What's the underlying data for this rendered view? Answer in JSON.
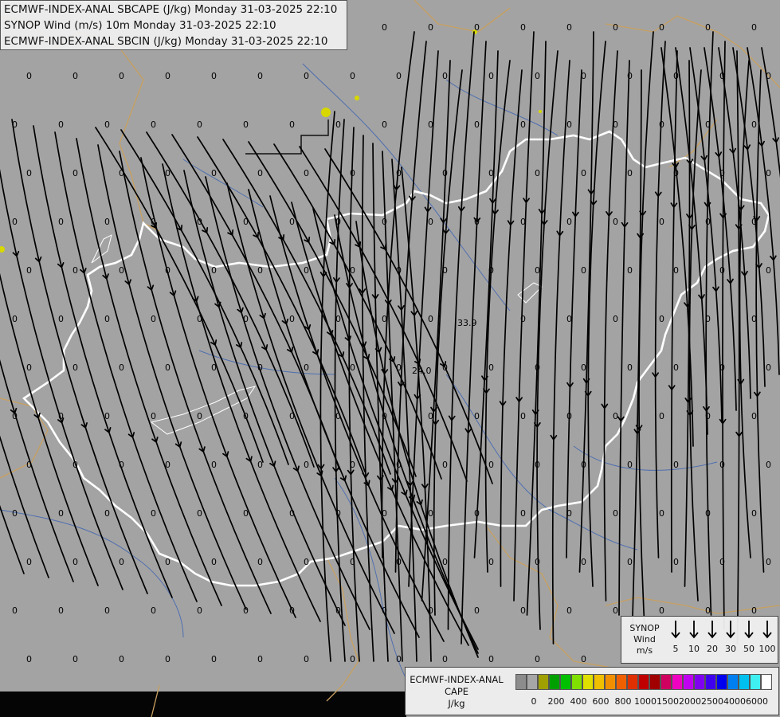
{
  "title": {
    "line1": "ECMWF-INDEX-ANAL SBCAPE (J/kg) Monday 31-03-2025 22:10",
    "line2": "SYNOP Wind (m/s) 10m Monday 31-03-2025 22:10",
    "line3": "ECMWF-INDEX-ANAL SBCIN (J/kg) Monday 31-03-2025 22:10"
  },
  "cape_values": {
    "zero_label": "0",
    "notable": [
      {
        "label": "33.9"
      },
      {
        "label": "24.0"
      }
    ]
  },
  "wind_legend": {
    "header": [
      "SYNOP",
      "Wind",
      "m/s"
    ],
    "speeds": [
      "5",
      "10",
      "20",
      "30",
      "50",
      "100"
    ]
  },
  "cape_legend": {
    "header": [
      "ECMWF-INDEX-ANAL",
      "CAPE",
      "J/kg"
    ],
    "colors": [
      "#8c8c8c",
      "#a6a6a6",
      "#a0a000",
      "#00a000",
      "#00c000",
      "#80e000",
      "#e0e000",
      "#f0c000",
      "#f09000",
      "#f06000",
      "#e03000",
      "#c00000",
      "#a00000",
      "#d00060",
      "#f000c0",
      "#c000f0",
      "#8000f0",
      "#4000f0",
      "#0000f0",
      "#0080f0",
      "#00c0f0",
      "#40f0f0",
      "#ffffff"
    ],
    "ticks": [
      "0",
      "200",
      "400",
      "600",
      "800",
      "1000",
      "1500",
      "2000",
      "2500",
      "4000",
      "6000"
    ]
  }
}
